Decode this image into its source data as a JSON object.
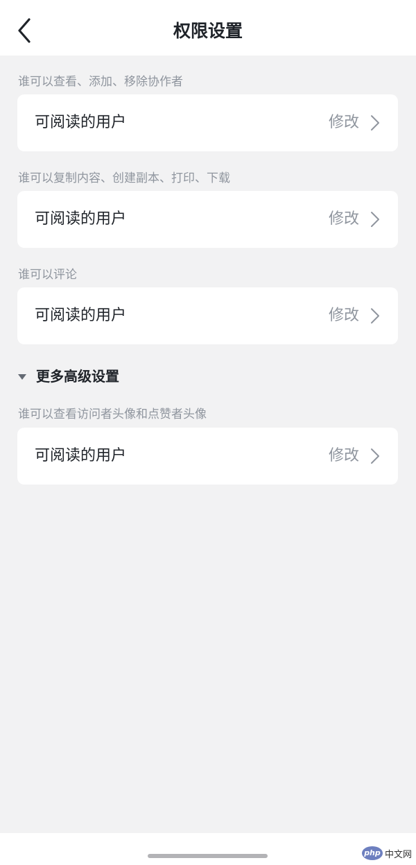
{
  "header": {
    "title": "权限设置"
  },
  "sections": [
    {
      "label": "谁可以查看、添加、移除协作者",
      "value": "可阅读的用户",
      "action": "修改"
    },
    {
      "label": "谁可以复制内容、创建副本、打印、下载",
      "value": "可阅读的用户",
      "action": "修改"
    },
    {
      "label": "谁可以评论",
      "value": "可阅读的用户",
      "action": "修改"
    }
  ],
  "more_settings": {
    "label": "更多高级设置",
    "sections": [
      {
        "label": "谁可以查看访问者头像和点赞者头像",
        "value": "可阅读的用户",
        "action": "修改"
      }
    ]
  },
  "watermark": {
    "badge": "php",
    "text": "中文网"
  }
}
